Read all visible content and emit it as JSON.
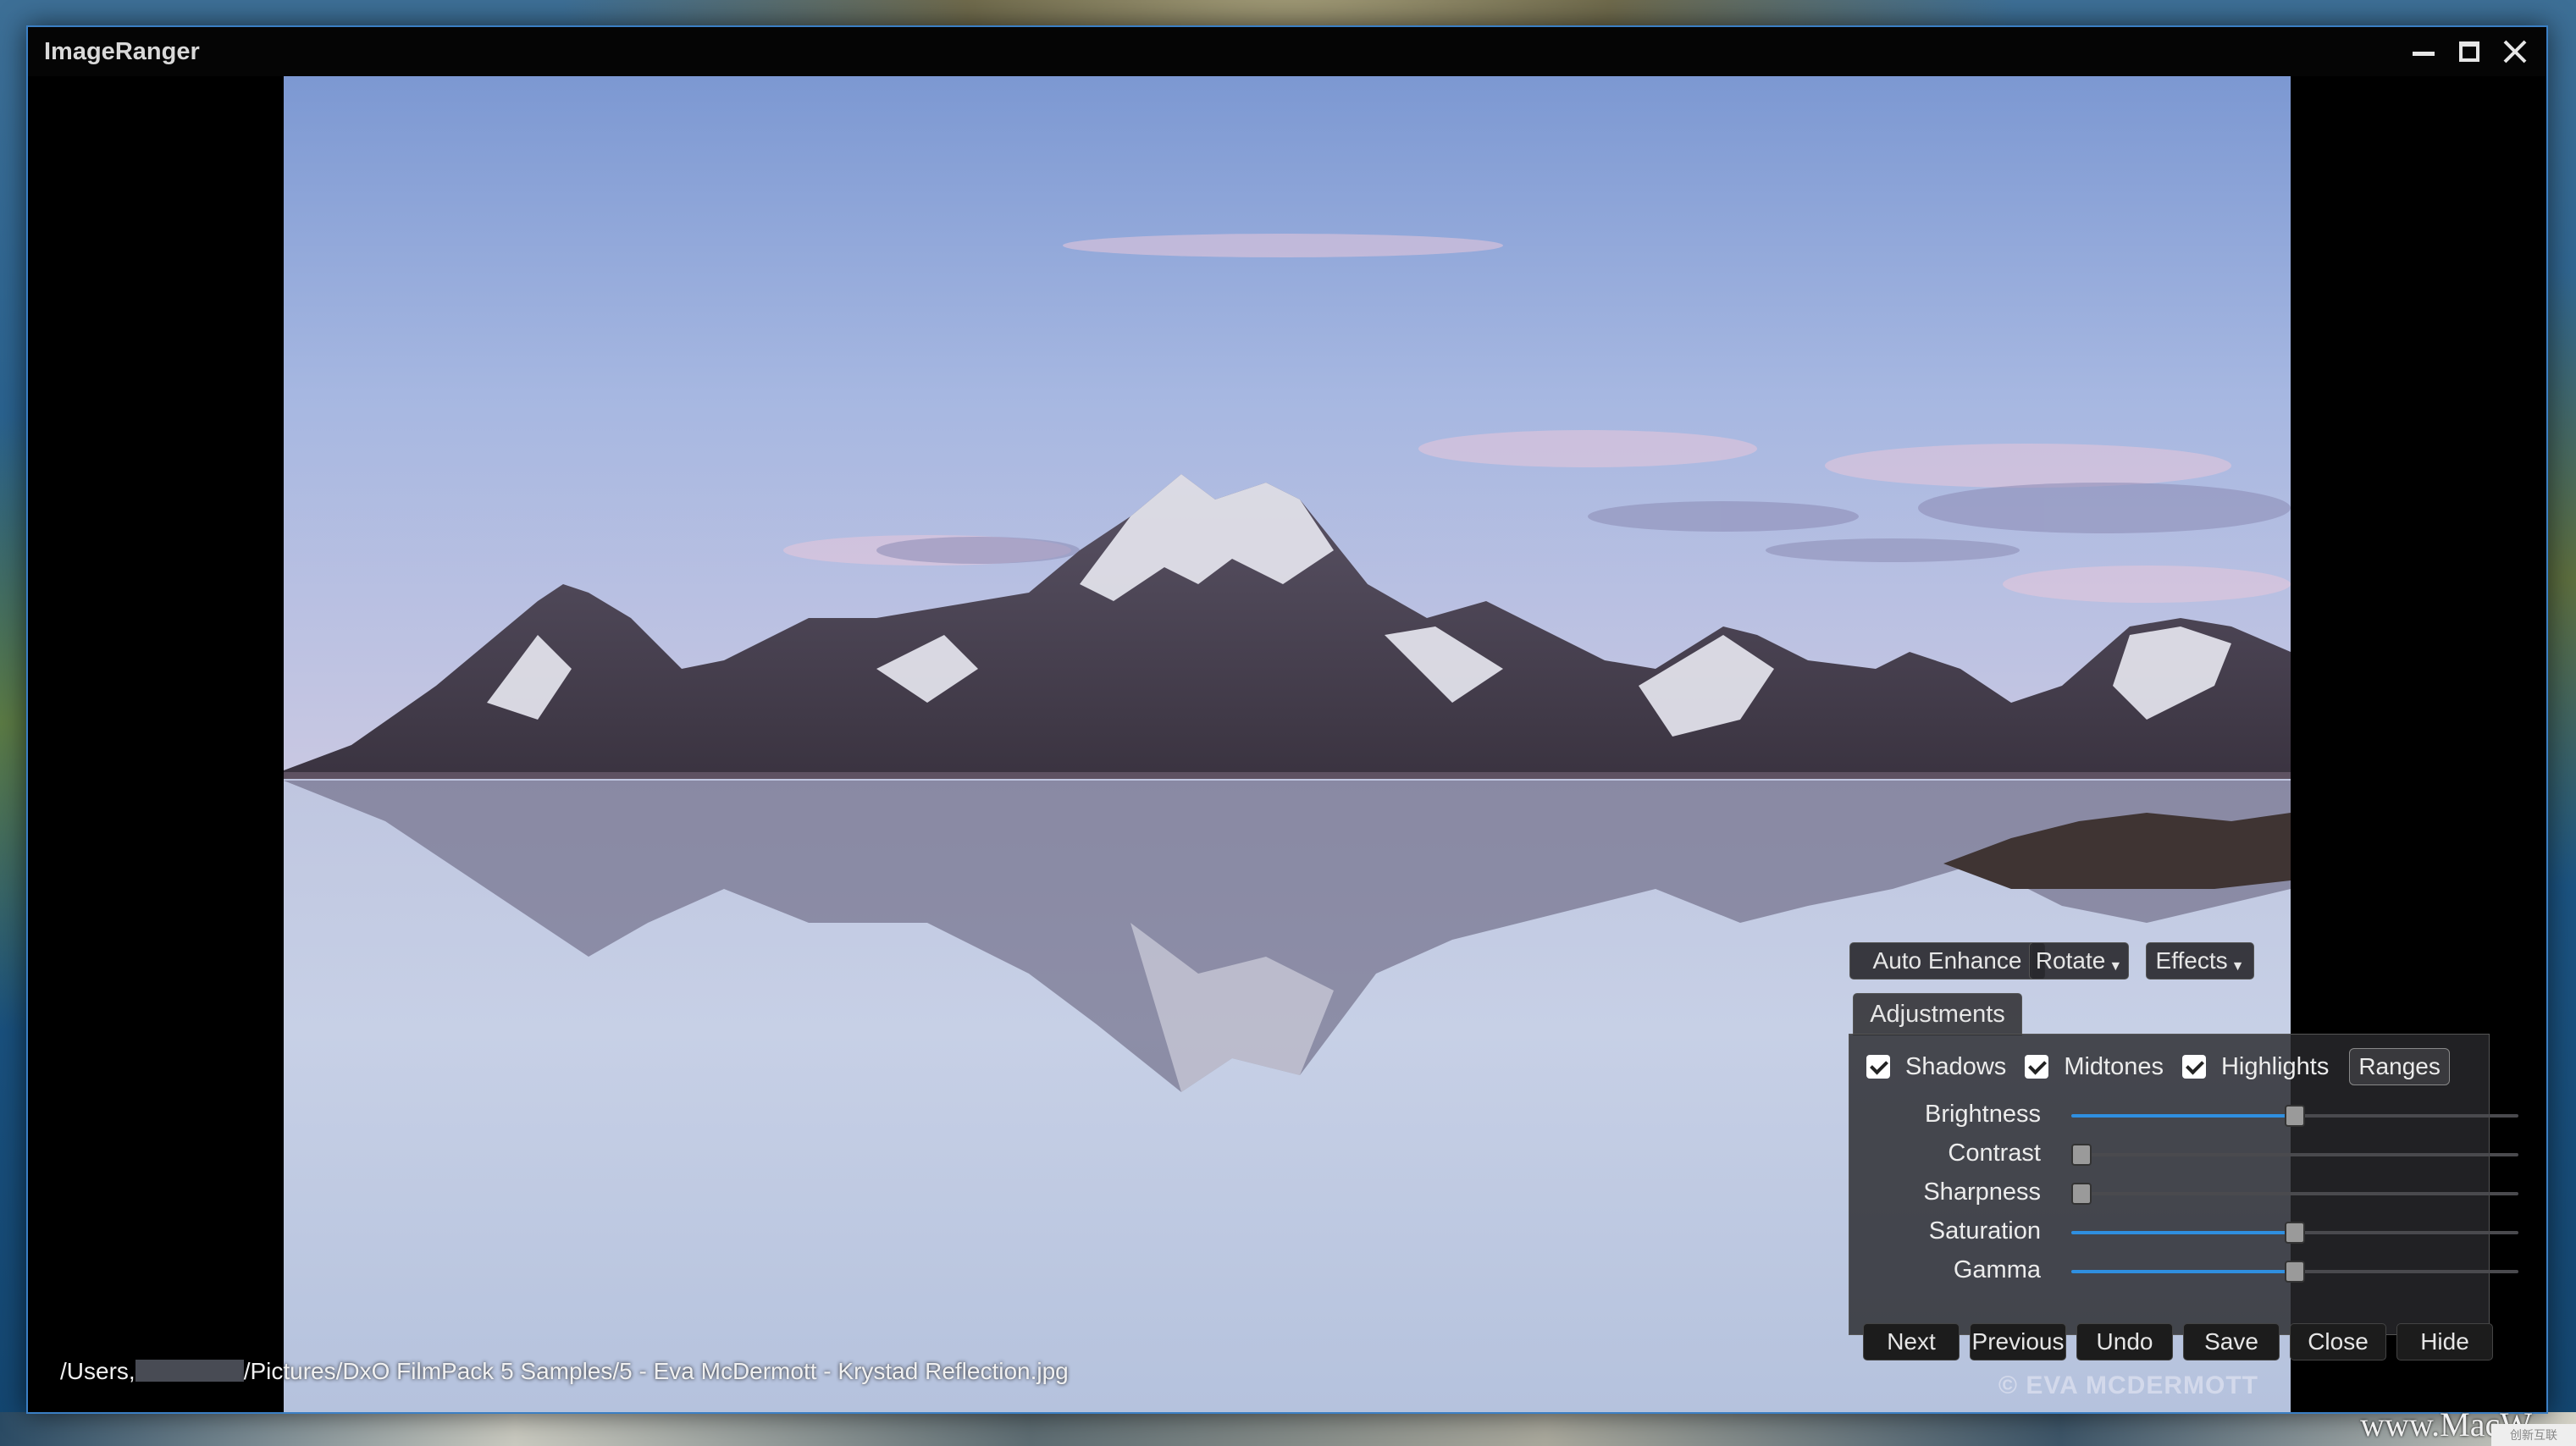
{
  "window": {
    "title": "ImageRanger"
  },
  "image": {
    "path_prefix": "/Users,",
    "path_suffix": "/Pictures/DxO FilmPack 5 Samples/5 - Eva McDermott - Krystad Reflection.jpg",
    "watermark": "© EVA MCDERMOTT"
  },
  "toolbar": {
    "auto_enhance": "Auto Enhance",
    "rotate": "Rotate",
    "effects": "Effects"
  },
  "adjustments": {
    "tab_label": "Adjustments",
    "checks": [
      {
        "label": "Shadows",
        "checked": true
      },
      {
        "label": "Midtones",
        "checked": true
      },
      {
        "label": "Highlights",
        "checked": true
      }
    ],
    "ranges_label": "Ranges",
    "sliders": [
      {
        "label": "Brightness",
        "value": 0.5,
        "filled": true
      },
      {
        "label": "Contrast",
        "value": 0.0,
        "filled": false
      },
      {
        "label": "Sharpness",
        "value": 0.0,
        "filled": false
      },
      {
        "label": "Saturation",
        "value": 0.5,
        "filled": true
      },
      {
        "label": "Gamma",
        "value": 0.5,
        "filled": true
      }
    ]
  },
  "actions": {
    "next": "Next",
    "previous": "Previous",
    "undo": "Undo",
    "save": "Save",
    "close": "Close",
    "hide": "Hide"
  },
  "desktop": {
    "logo_text": "www.MacW",
    "badge_text": "创新互联"
  }
}
